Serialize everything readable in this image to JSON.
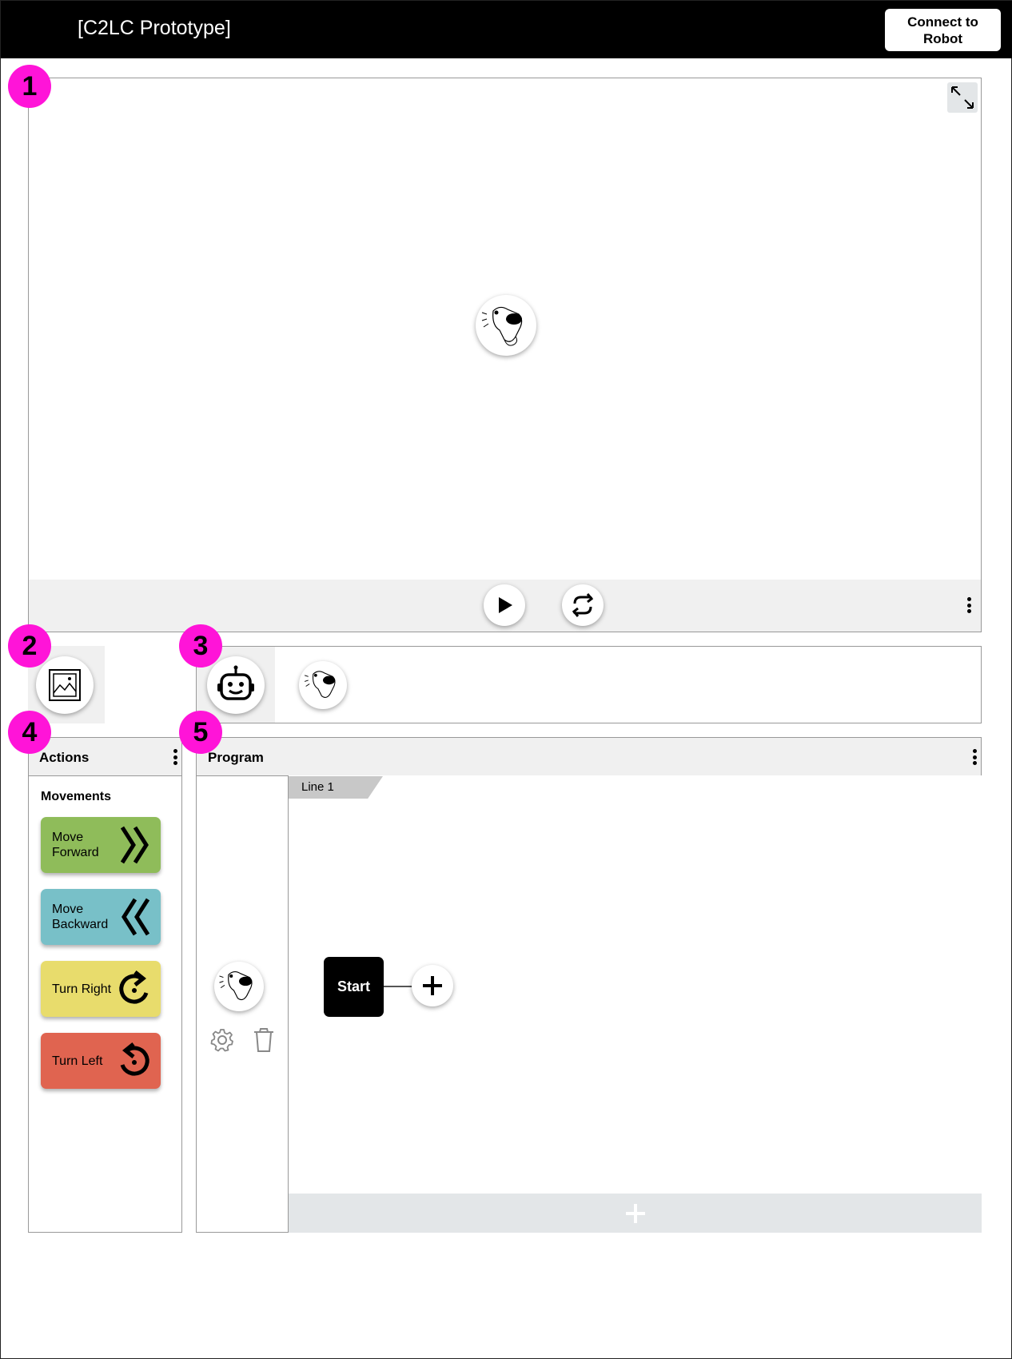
{
  "header": {
    "app_title": "[C2LC Prototype]",
    "connect_label": "Connect to Robot"
  },
  "badges": [
    "1",
    "2",
    "3",
    "4",
    "5"
  ],
  "scene": {
    "expand_icon": "expand-icon",
    "robot_icon": "robot-character-icon",
    "controls": {
      "play_icon": "play-icon",
      "refresh_icon": "refresh-icon",
      "menu_icon": "kebab-menu-icon"
    }
  },
  "background_selector": {
    "icon": "image-icon"
  },
  "character_selector": {
    "selected_icon": "robot-face-icon",
    "option_icon": "robot-character-icon"
  },
  "actions": {
    "title": "Actions",
    "section": "Movements",
    "items": [
      {
        "label": "Move Forward",
        "color": "#8fbc5a",
        "icon": "double-chevron-right-icon"
      },
      {
        "label": "Move Backward",
        "color": "#78c0c8",
        "icon": "double-chevron-left-icon"
      },
      {
        "label": "Turn Right",
        "color": "#e8dc6c",
        "icon": "turn-right-icon"
      },
      {
        "label": "Turn Left",
        "color": "#e06450",
        "icon": "turn-left-icon"
      }
    ]
  },
  "program": {
    "title": "Program",
    "line_label": "Line 1",
    "start_label": "Start",
    "settings_icon": "gear-icon",
    "delete_icon": "trash-icon",
    "add_step_icon": "plus-icon",
    "add_line_icon": "plus-icon"
  },
  "colors": {
    "badge": "#ff14d8",
    "header_bg": "#000000",
    "panel_bg": "#f0f0f0"
  }
}
